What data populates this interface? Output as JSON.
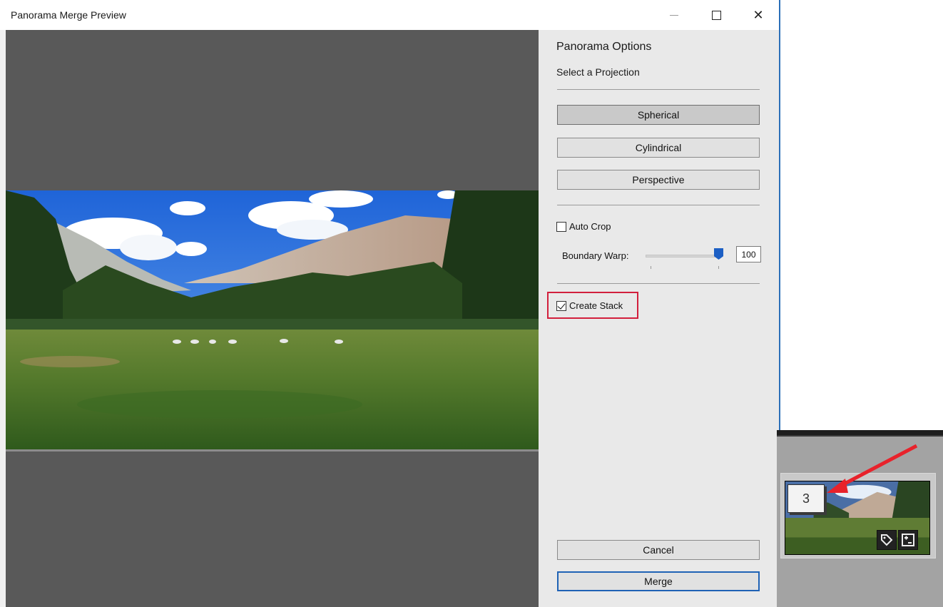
{
  "window": {
    "title": "Panorama Merge Preview",
    "close_glyph": "✕"
  },
  "panel": {
    "heading": "Panorama Options",
    "subheading": "Select a Projection",
    "projections": [
      {
        "label": "Spherical",
        "selected": true
      },
      {
        "label": "Cylindrical",
        "selected": false
      },
      {
        "label": "Perspective",
        "selected": false
      }
    ],
    "auto_crop": {
      "label": "Auto Crop",
      "checked": false
    },
    "boundary_warp": {
      "label": "Boundary Warp:",
      "value": "100"
    },
    "create_stack": {
      "label": "Create Stack",
      "checked": true
    },
    "cancel_label": "Cancel",
    "merge_label": "Merge"
  },
  "inset": {
    "stack_count": "3",
    "badge_icons": [
      "tag-icon",
      "adjust-icon"
    ]
  },
  "colors": {
    "accent_blue": "#1c5fc4",
    "highlight_red": "#d21f3c",
    "arrow_red": "#e8222b"
  }
}
